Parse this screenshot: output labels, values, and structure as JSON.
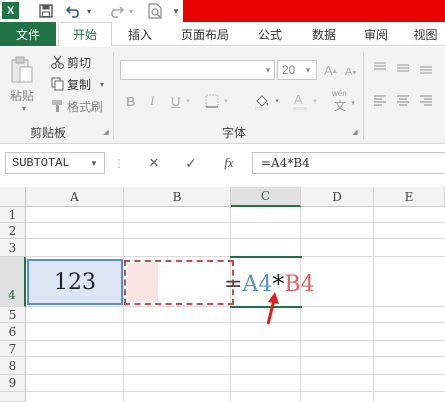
{
  "app": {
    "logo": "X",
    "accent": "#217346",
    "title_bar_color": "#e60000"
  },
  "qat_icons": [
    "excel-icon",
    "save-icon",
    "undo-icon",
    "redo-icon",
    "print-preview-icon"
  ],
  "tabs": {
    "file": "文件",
    "items": [
      "开始",
      "插入",
      "页面布局",
      "公式",
      "数据",
      "审阅",
      "视图"
    ]
  },
  "ribbon": {
    "paste": "粘贴",
    "cut": "剪切",
    "copy": "复制",
    "format_painter": "格式刷",
    "clipboard_group": "剪贴板",
    "font_size": "20",
    "font_group": "字体",
    "bold": "B",
    "italic": "I",
    "underline": "U",
    "wen": "wén",
    "wen_char": "文"
  },
  "formula_bar": {
    "name_box": "SUBTOTAL",
    "cancel": "✕",
    "enter": "✓",
    "fx": "fx",
    "formula": "=A4*B4"
  },
  "grid": {
    "columns": [
      "A",
      "B",
      "C",
      "D",
      "E"
    ],
    "rows": [
      "1",
      "2",
      "3",
      "4",
      "5",
      "6",
      "7",
      "8",
      "9"
    ],
    "cell_a4": "123",
    "c4_prefix": "=",
    "c4_ref1": "A4",
    "c4_op": "*",
    "c4_ref2": "B4",
    "ref1_color": "#5b8fc9",
    "ref2_color": "#d9626a",
    "arrow_color": "#e02020"
  }
}
